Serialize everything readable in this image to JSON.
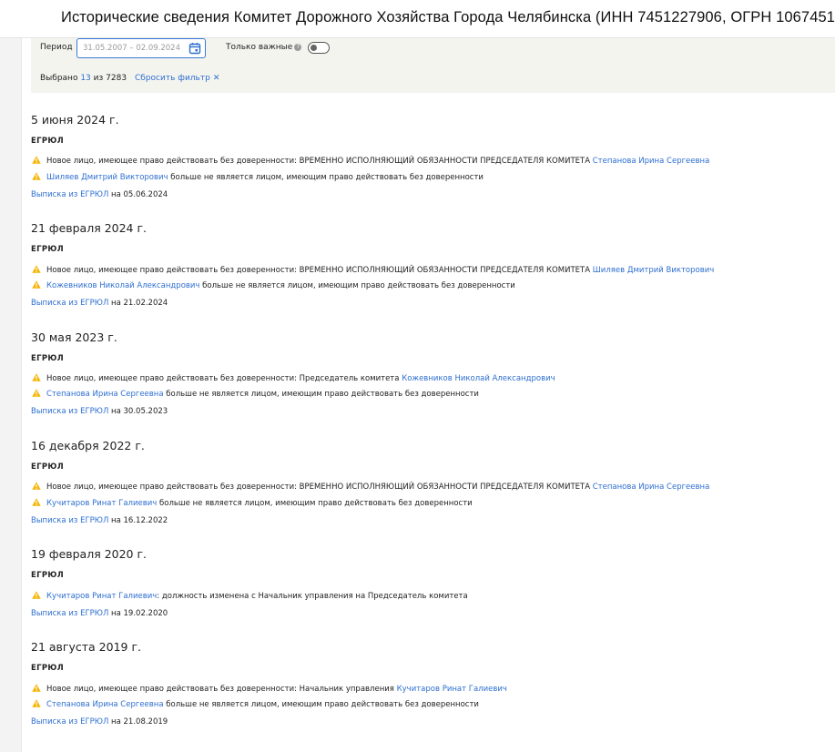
{
  "header": {
    "title": "Исторические сведения Комитет Дорожного Хозяйства Города Челябинска (ИНН 7451227906, ОГРН 1067451"
  },
  "filter": {
    "period_label": "Период",
    "period_value": "31.05.2007 – 02.09.2024",
    "important_label": "Только важные",
    "important_on": false,
    "selected_prefix": "Выбрано",
    "selected_count": "13",
    "selected_mid": "из",
    "selected_total": "7283",
    "reset_label": "Сбросить фильтр",
    "reset_x": "✕"
  },
  "colors": {
    "link": "#2e6fd0",
    "warning": "#f5b400",
    "filter_bg": "#f4f4ef"
  },
  "entries": [
    {
      "date": "5 июня 2024 г.",
      "source": "ЕГРЮЛ",
      "lines": [
        {
          "pre": "Новое лицо, имеющее право действовать без доверенности: ВРЕМЕННО ИСПОЛНЯЮЩИЙ ОБЯЗАННОСТИ ПРЕДСЕДАТЕЛЯ КОМИТЕТА ",
          "link": "Степанова Ирина Сергеевна",
          "post": ""
        },
        {
          "pre": "",
          "link": "Шиляев Дмитрий Викторович",
          "post": " больше не является лицом, имеющим право действовать без доверенности"
        }
      ],
      "extract_link": "Выписка из ЕГРЮЛ",
      "extract_text": " на 05.06.2024"
    },
    {
      "date": "21 февраля 2024 г.",
      "source": "ЕГРЮЛ",
      "lines": [
        {
          "pre": "Новое лицо, имеющее право действовать без доверенности: ВРЕМЕННО ИСПОЛНЯЮЩИЙ ОБЯЗАННОСТИ ПРЕДСЕДАТЕЛЯ КОМИТЕТА ",
          "link": "Шиляев Дмитрий Викторович",
          "post": ""
        },
        {
          "pre": "",
          "link": "Кожевников Николай Александрович",
          "post": " больше не является лицом, имеющим право действовать без доверенности"
        }
      ],
      "extract_link": "Выписка из ЕГРЮЛ",
      "extract_text": " на 21.02.2024"
    },
    {
      "date": "30 мая 2023 г.",
      "source": "ЕГРЮЛ",
      "lines": [
        {
          "pre": "Новое лицо, имеющее право действовать без доверенности: Председатель комитета ",
          "link": "Кожевников Николай Александрович",
          "post": ""
        },
        {
          "pre": "",
          "link": "Степанова Ирина Сергеевна",
          "post": " больше не является лицом, имеющим право действовать без доверенности"
        }
      ],
      "extract_link": "Выписка из ЕГРЮЛ",
      "extract_text": " на 30.05.2023"
    },
    {
      "date": "16 декабря 2022 г.",
      "source": "ЕГРЮЛ",
      "lines": [
        {
          "pre": "Новое лицо, имеющее право действовать без доверенности: ВРЕМЕННО ИСПОЛНЯЮЩИЙ ОБЯЗАННОСТИ ПРЕДСЕДАТЕЛЯ КОМИТЕТА ",
          "link": "Степанова Ирина Сергеевна",
          "post": ""
        },
        {
          "pre": "",
          "link": "Кучитаров Ринат Галиевич",
          "post": " больше не является лицом, имеющим право действовать без доверенности"
        }
      ],
      "extract_link": "Выписка из ЕГРЮЛ",
      "extract_text": " на 16.12.2022"
    },
    {
      "date": "19 февраля 2020 г.",
      "source": "ЕГРЮЛ",
      "lines": [
        {
          "pre": "",
          "link": "Кучитаров Ринат Галиевич",
          "post": ": должность изменена с Начальник управления на Председатель комитета"
        }
      ],
      "extract_link": "Выписка из ЕГРЮЛ",
      "extract_text": " на 19.02.2020"
    },
    {
      "date": "21 августа 2019 г.",
      "source": "ЕГРЮЛ",
      "lines": [
        {
          "pre": "Новое лицо, имеющее право действовать без доверенности: Начальник управления ",
          "link": "Кучитаров Ринат Галиевич",
          "post": ""
        },
        {
          "pre": "",
          "link": "Степанова Ирина Сергеевна",
          "post": " больше не является лицом, имеющим право действовать без доверенности"
        }
      ],
      "extract_link": "Выписка из ЕГРЮЛ",
      "extract_text": " на 21.08.2019"
    }
  ]
}
